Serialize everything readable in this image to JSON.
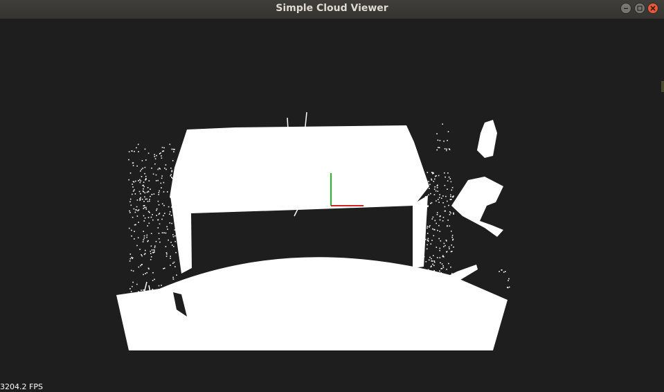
{
  "window": {
    "title": "Simple Cloud Viewer",
    "buttons": {
      "minimize": "minimize-icon",
      "maximize": "maximize-icon",
      "close": "close-icon"
    }
  },
  "viewport": {
    "background": "#1e1e1e",
    "point_color": "#ffffff",
    "fps_text": "3204.2 FPS",
    "axes": {
      "x_color": "#cc2222",
      "y_color": "#22bb22"
    }
  }
}
